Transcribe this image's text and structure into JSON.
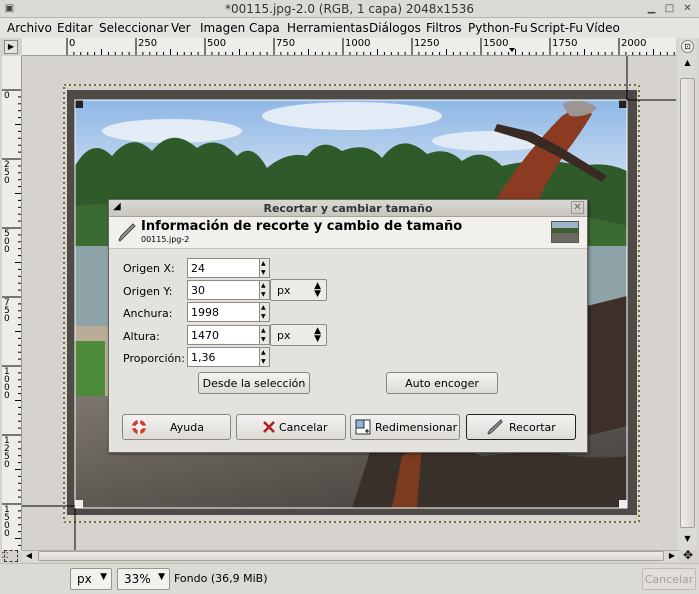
{
  "window": {
    "title": "*00115.jpg-2.0 (RGB, 1 capa) 2048x1536"
  },
  "menu": [
    "Archivo",
    "Editar",
    "Seleccionar",
    "Ver",
    "Imagen",
    "Capa",
    "Herramientas",
    "Diálogos",
    "Filtros",
    "Python-Fu",
    "Script-Fu",
    "Vídeo"
  ],
  "ruler": {
    "h_labels": [
      "0",
      "250",
      "500",
      "750",
      "1000",
      "1250",
      "1500",
      "1750",
      "2000"
    ],
    "v_labels": [
      "0",
      "250",
      "500",
      "750",
      "1000",
      "1250",
      "1500"
    ]
  },
  "dialog": {
    "title": "Recortar y cambiar tamaño",
    "heading": "Información de recorte y cambio de tamaño",
    "subheading": "00115.jpg-2",
    "origin_x_label": "Origen X:",
    "origin_x": "24",
    "origin_y_label": "Origen Y:",
    "origin_y": "30",
    "unit_1": "px",
    "width_label": "Anchura:",
    "width": "1998",
    "height_label": "Altura:",
    "height": "1470",
    "unit_2": "px",
    "ratio_label": "Proporción:",
    "ratio": "1,36",
    "from_selection": "Desde la selección",
    "auto_shrink": "Auto encoger",
    "help": "Ayuda",
    "cancel": "Cancelar",
    "resize": "Redimensionar",
    "crop": "Recortar"
  },
  "status": {
    "unit": "px",
    "zoom": "33%",
    "layer_info": "Fondo (36,9 MiB)",
    "cancel": "Cancelar"
  }
}
